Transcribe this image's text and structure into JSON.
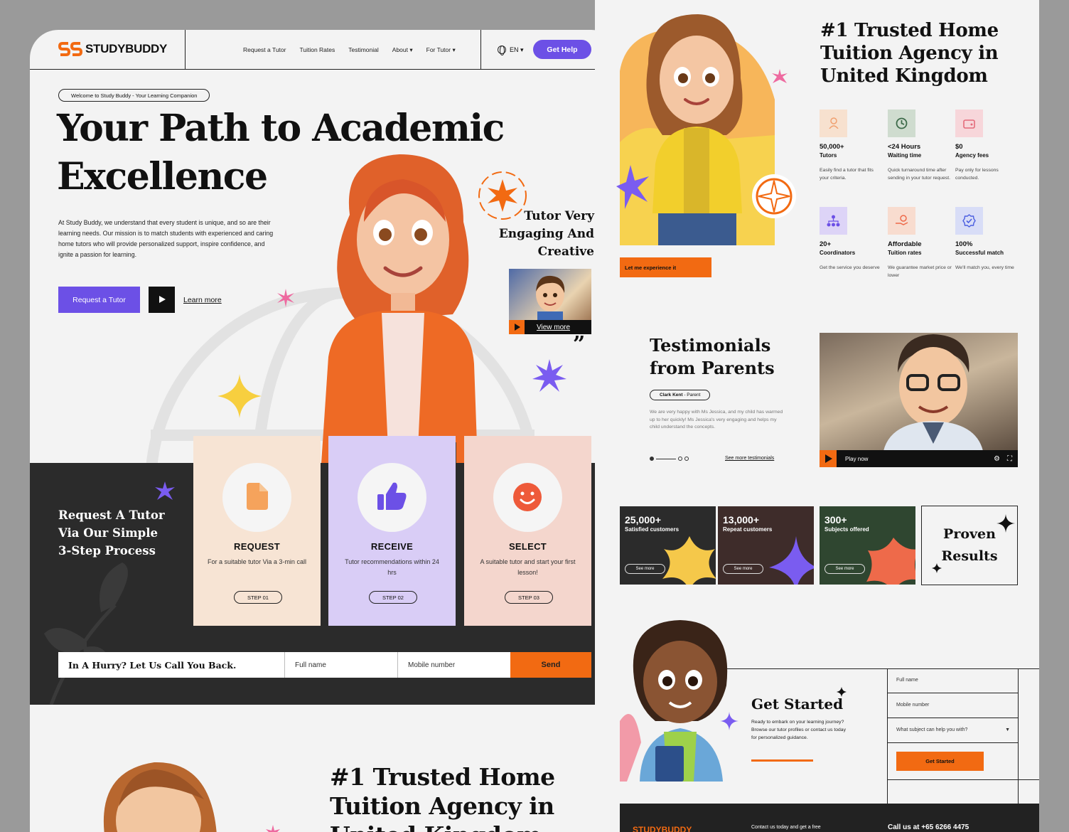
{
  "brand": {
    "name": "STUDYBUDDY",
    "accent": "#6c50e6",
    "orange": "#f26a12"
  },
  "nav": {
    "items": [
      "Request a Tutor",
      "Tuition Rates",
      "Testimonial",
      "About ▾",
      "For Tutor ▾"
    ],
    "lang": "EN ▾",
    "cta": "Get Help"
  },
  "hero": {
    "pill": "Welcome to Study Buddy - Your Learning Companion",
    "title_line1": "Your Path to Academic",
    "title_line2": "Excellence",
    "desc": "At Study Buddy, we understand that every student is unique, and so are their learning needs. Our mission is to match students with experienced and caring home tutors who will provide personalized support, inspire confidence, and ignite a passion for learning.",
    "btn_request": "Request a Tutor",
    "btn_learn": "Learn more",
    "tag_line1": "Tutor Very",
    "tag_line2": "Engaging And",
    "tag_line3": "Creative",
    "video_label": "View more",
    "quote": "”"
  },
  "steps": {
    "title_line1": "Request A Tutor",
    "title_line2": "Via Our Simple",
    "title_line3": "3-Step Process",
    "items": [
      {
        "title": "REQUEST",
        "desc": "For a suitable tutor Via a 3-min call",
        "pill": "STEP 01",
        "color": "#f7e4d4"
      },
      {
        "title": "RECEIVE",
        "desc": "Tutor recommendations within 24 hrs",
        "pill": "STEP 02",
        "color": "#d9cdf6"
      },
      {
        "title": "SELECT",
        "desc": "A suitable tutor and start your first lesson!",
        "pill": "STEP 03",
        "color": "#f4d6cd"
      }
    ]
  },
  "callback": {
    "title": "In A Hurry? Let Us Call You Back.",
    "name_placeholder": "Full name",
    "mobile_placeholder": "Mobile number",
    "send": "Send"
  },
  "bottom": {
    "title_line1": "#1 Trusted Home",
    "title_line2": "Tuition Agency in",
    "title_line3": "United Kingdom"
  },
  "right": {
    "title_line1": "#1 Trusted Home",
    "title_line2": "Tuition Agency in",
    "title_line3": "United Kingdom",
    "experience_btn": "Let me experience it",
    "features": [
      {
        "head": "50,000+",
        "sub": "Tutors",
        "desc": "Easily find a tutor that fits your criteria.",
        "icon": "user-icon",
        "bg": "#f7e1cf"
      },
      {
        "head": "<24 Hours",
        "sub": "Waiting time",
        "desc": "Quick turnaround time after sending in your tutor request.",
        "icon": "clock-icon",
        "bg": "#cfdccf"
      },
      {
        "head": "$0",
        "sub": "Agency fees",
        "desc": "Pay only for lessons conducted.",
        "icon": "wallet-icon",
        "bg": "#f7d6da"
      },
      {
        "head": "20+",
        "sub": "Coordinators",
        "desc": "Get the service you deserve",
        "icon": "hierarchy-icon",
        "bg": "#ddd4f7"
      },
      {
        "head": "Affordable",
        "sub": "Tuition rates",
        "desc": "We guarantee market price or lower",
        "icon": "hand-coin-icon",
        "bg": "#f8dccf"
      },
      {
        "head": "100%",
        "sub": "Successful match",
        "desc": "We'll match you, every time",
        "icon": "badge-check-icon",
        "bg": "#d8ddf7"
      }
    ],
    "testimonials": {
      "title_line1": "Testimonials",
      "title_line2": "from Parents",
      "author": "Clark Kent",
      "role": "- Parent",
      "text": "We are very happy with Ms Jessica, and my child has warmed up to her quickly! Ms Jessica's very engaging and helps my child understand the concepts.",
      "see_more": "See more testimonials",
      "play_label": "Play now"
    },
    "stats": [
      {
        "num": "25,000+",
        "label": "Satisfied customers",
        "btn": "See more",
        "bg": "#2b2b2b",
        "shape": "#f5c84a"
      },
      {
        "num": "13,000+",
        "label": "Repeat customers",
        "btn": "See more",
        "bg": "#3e2c2a",
        "shape": "#7a5cf0"
      },
      {
        "num": "300+",
        "label": "Subjects offered",
        "btn": "See more",
        "bg": "#2f4630",
        "shape": "#ee6a4a"
      }
    ],
    "proven_line1": "Proven",
    "proven_line2": "Results",
    "get_started": {
      "title": "Get Started",
      "desc": "Ready to embark on your learning journey? Browse our tutor profiles or contact us today for personalized guidance.",
      "field_name": "Full name",
      "field_mobile": "Mobile number",
      "field_subject": "What subject can help you with?",
      "btn": "Get Started"
    },
    "footer": {
      "brand": "STUDYBUDDY",
      "contact_text": "Contact us today and get a free",
      "phone": "Call us at +65 6266 4475"
    }
  }
}
